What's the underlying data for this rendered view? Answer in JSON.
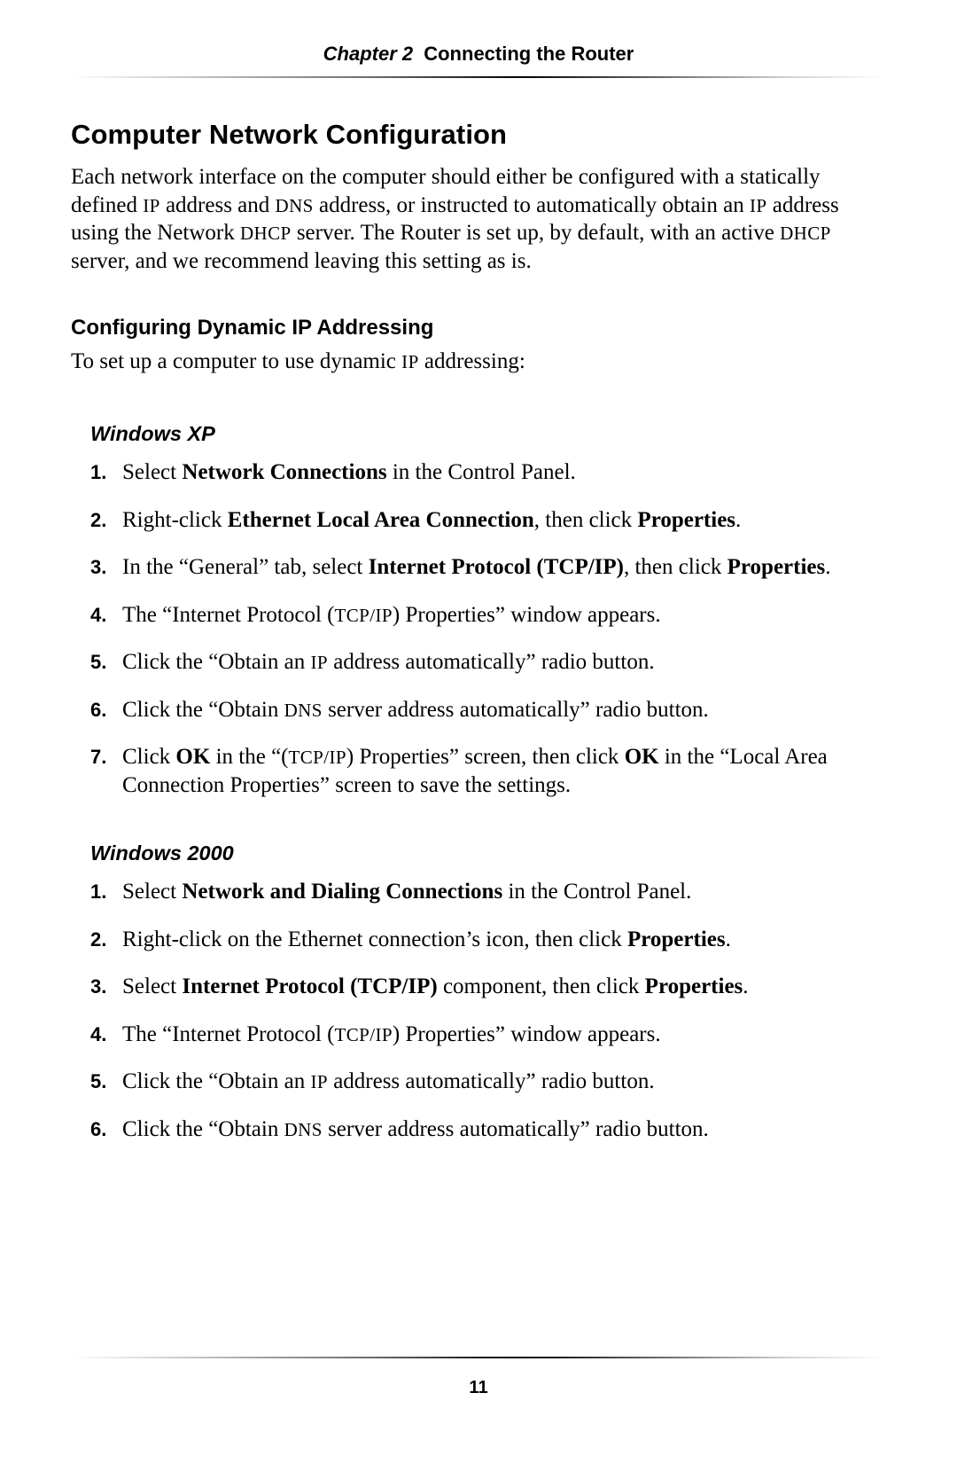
{
  "header": {
    "chapter_label": "Chapter 2 ",
    "chapter_title": "Connecting the Router"
  },
  "section_title": "Computer Network Configuration",
  "intro_html": "Each network interface on the computer should either be configured with a statically defined <span class=\"sc\">IP</span> address and <span class=\"sc\">DNS</span> address, or instructed to automatically obtain an <span class=\"sc\">IP</span> address using the Network <span class=\"sc\">DHCP</span> server. The Router is set up, by default, with an active <span class=\"sc\">DHCP</span> server, and we recommend leaving this setting as is.",
  "sub_title": "Configuring Dynamic IP Addressing",
  "lead_html": "To set up a computer to use dynamic <span class=\"sc\">IP</span> addressing:",
  "groups": [
    {
      "title": "Windows XP",
      "steps": [
        "Select <b>Network Connections</b> in the Control Panel.",
        "Right-click <b>Ethernet Local Area Connection</b>, then click <b>Properties</b>.",
        "In the “General” tab, select <b>Internet Protocol (TCP/IP)</b>, then click <b>Properties</b>.",
        "The “Internet Protocol (<span class=\"sc\">TCP/IP</span>) Properties” window appears.",
        "Click the “Obtain an <span class=\"sc\">IP</span> address automatically” radio button.",
        "Click the “Obtain <span class=\"sc\">DNS</span> server address automatically” radio button.",
        "Click <b>OK</b> in the “(<span class=\"sc\">TCP/IP</span>) Properties” screen, then click <b>OK</b> in the “Local Area Connection Properties” screen to save the settings."
      ]
    },
    {
      "title": "Windows 2000",
      "steps": [
        "Select <b>Network and Dialing Connections</b> in the Control Panel.",
        "Right-click on the Ethernet connection’s icon, then click <b>Properties</b>.",
        "Select <b>Internet Protocol (TCP/IP)</b> component, then click <b>Properties</b>.",
        "The “Internet Protocol (<span class=\"sc\">TCP/IP</span>) Properties” window appears.",
        "Click the “Obtain an <span class=\"sc\">IP</span> address automatically” radio button.",
        "Click the “Obtain <span class=\"sc\">DNS</span> server address automatically” radio button."
      ]
    }
  ],
  "page_number": "11"
}
